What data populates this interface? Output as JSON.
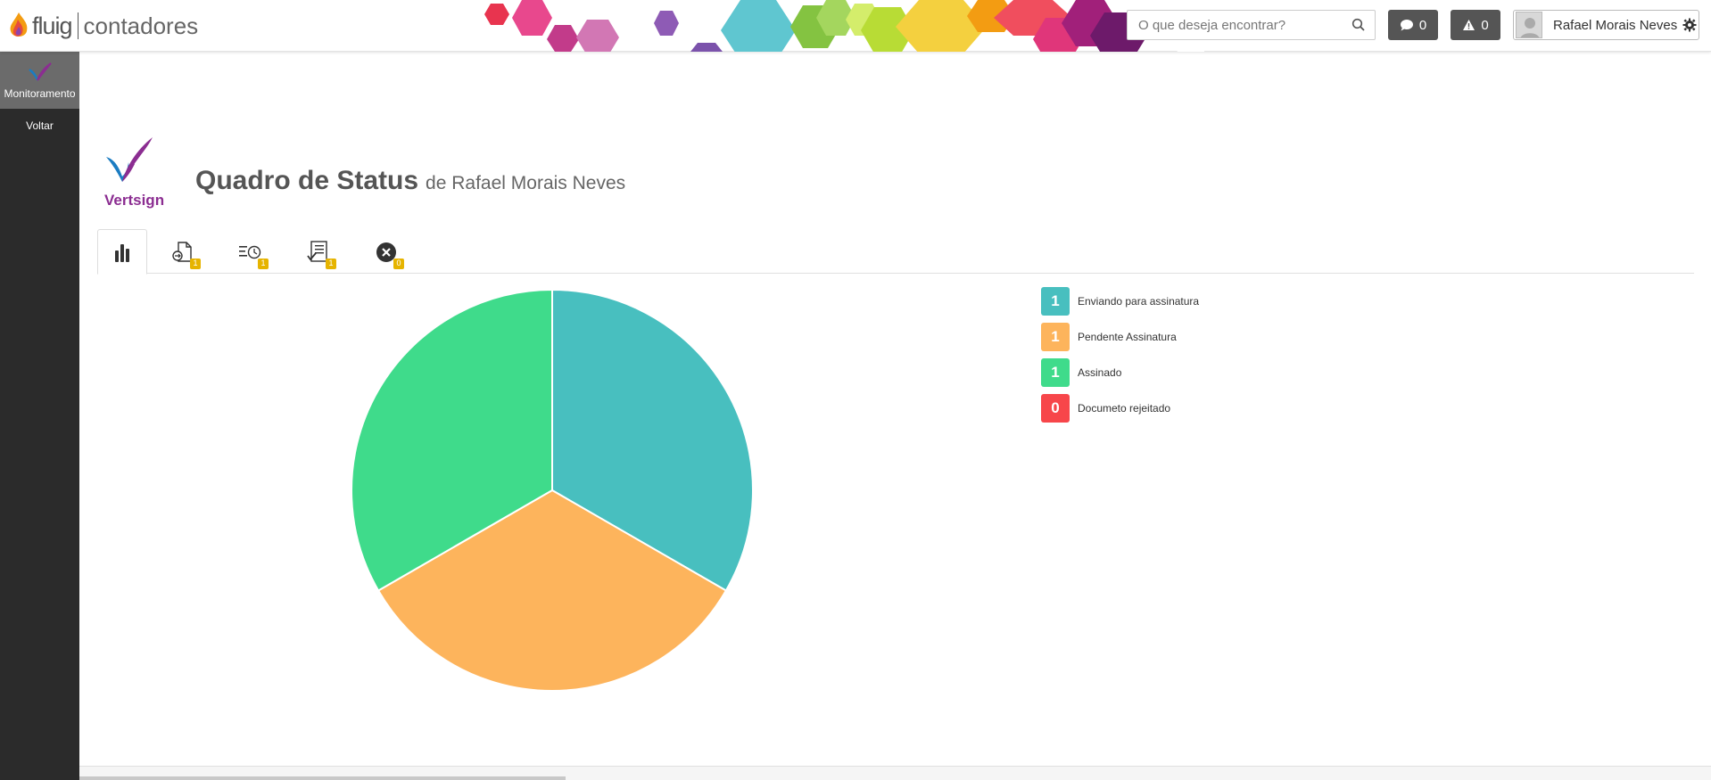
{
  "header": {
    "brand_name": "fluig",
    "company": "contadores",
    "search_placeholder": "O que deseja encontrar?",
    "messages_count": "0",
    "alerts_count": "0",
    "user_name": "Rafael Morais Neves",
    "icons": [
      "search-icon",
      "chat-icon",
      "warning-icon",
      "gear-icon"
    ]
  },
  "sidebar": {
    "items": [
      {
        "label": "Monitoramento",
        "icon": "vertsign-check-icon",
        "active": true
      },
      {
        "label": "Voltar",
        "active": false
      }
    ]
  },
  "page": {
    "logo_text": "Vertsign",
    "title": "Quadro de Status",
    "subtitle": "de Rafael Morais Neves"
  },
  "tabs": [
    {
      "icon": "bar-chart-icon",
      "badge": "",
      "active": true
    },
    {
      "icon": "document-send-icon",
      "badge": "1"
    },
    {
      "icon": "list-clock-icon",
      "badge": "1"
    },
    {
      "icon": "checklist-icon",
      "badge": "1"
    },
    {
      "icon": "close-circle-icon",
      "badge": "0"
    }
  ],
  "legend": [
    {
      "count": "1",
      "label": "Enviando para assinatura",
      "color": "#48bfbf"
    },
    {
      "count": "1",
      "label": "Pendente Assinatura",
      "color": "#fdb45c"
    },
    {
      "count": "1",
      "label": "Assinado",
      "color": "#3fdb8b"
    },
    {
      "count": "0",
      "label": "Documeto rejeitado",
      "color": "#f7464a"
    }
  ],
  "chart_data": {
    "type": "pie",
    "categories": [
      "Enviando para assinatura",
      "Pendente Assinatura",
      "Assinado",
      "Documeto rejeitado"
    ],
    "values": [
      1,
      1,
      1,
      0
    ],
    "colors": [
      "#48bfbf",
      "#fdb45c",
      "#3fdb8b",
      "#f7464a"
    ]
  }
}
